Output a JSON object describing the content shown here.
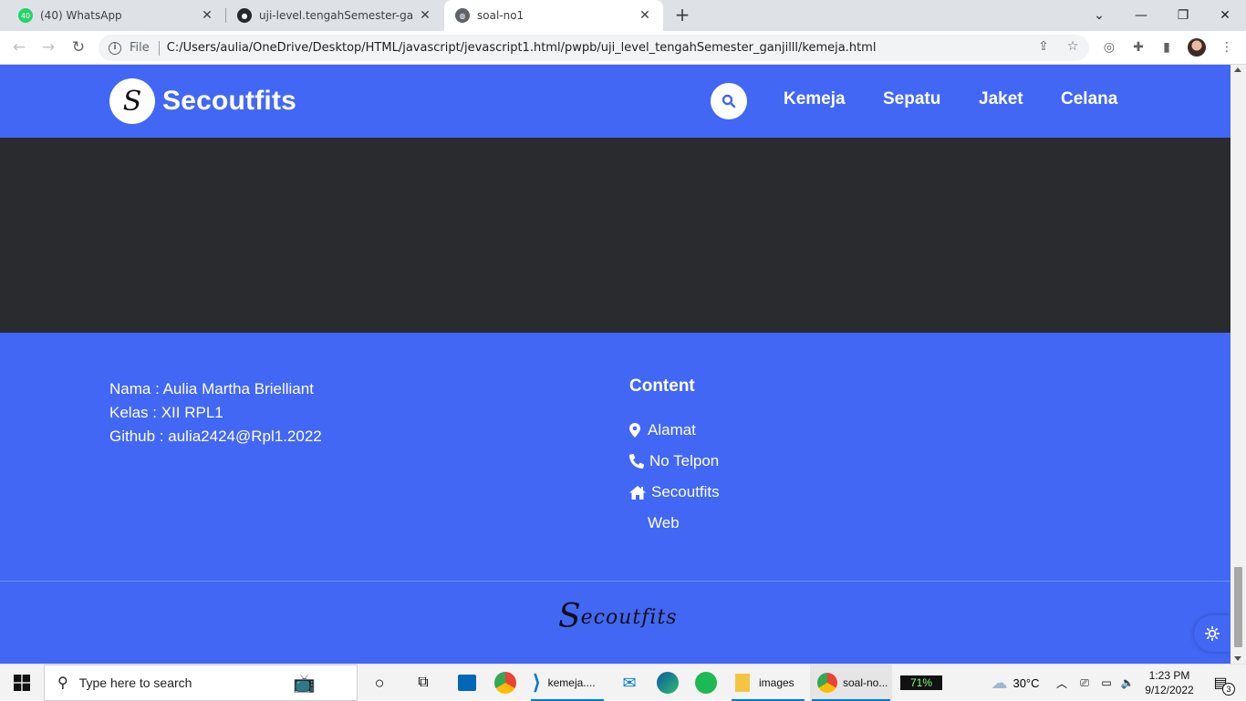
{
  "browser": {
    "tabs": [
      {
        "title": "(40) WhatsApp",
        "badge": "40",
        "active": false
      },
      {
        "title": "uji-level.tengahSemester-ganjil/u",
        "active": false
      },
      {
        "title": "soal-no1",
        "active": true
      }
    ],
    "new_tab": "+",
    "window_controls": {
      "minimize": "—",
      "restore": "❐",
      "close": "✕"
    },
    "address": {
      "scheme_label": "File",
      "url": "C:/Users/aulia/OneDrive/Desktop/HTML/javascript/jevascript1.html/pwpb/uji_level_tengahSemester_ganjilll/kemeja.html"
    }
  },
  "site": {
    "brand": "Secoutfits",
    "logo_letter": "S",
    "nav": [
      "Kemeja",
      "Sepatu",
      "Jaket",
      "Celana"
    ],
    "colors": {
      "primary": "#4267f5",
      "dark": "#2a2b2e"
    }
  },
  "footer": {
    "info": [
      "Nama : Aulia Martha Brielliant",
      "Kelas : XII RPL1",
      "Github : aulia2424@Rpl1.2022"
    ],
    "content_title": "Content",
    "content_items": [
      {
        "icon": "map-marker-icon",
        "label": "Alamat"
      },
      {
        "icon": "phone-icon",
        "label": "No Telpon"
      },
      {
        "icon": "home-icon",
        "label": "Secoutfits"
      },
      {
        "icon": "",
        "label": "Web"
      }
    ],
    "signature_first": "S",
    "signature_rest": "ecoutfits"
  },
  "taskbar": {
    "search_placeholder": "Type here to search",
    "apps": [
      {
        "label": "kemeja...."
      },
      {
        "label": "images"
      },
      {
        "label": "soal-no..."
      }
    ],
    "battery": "71%",
    "weather": "30°C",
    "time": "1:23 PM",
    "date": "9/12/2022",
    "notifications": "3"
  }
}
